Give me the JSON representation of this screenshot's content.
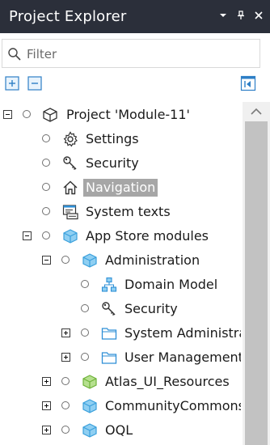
{
  "panel": {
    "title": "Project Explorer",
    "controls": [
      {
        "name": "dropdown-icon",
        "glyph": "▾"
      },
      {
        "name": "pin-icon",
        "glyph": "⊥"
      },
      {
        "name": "close-icon",
        "glyph": "✕"
      }
    ]
  },
  "filter": {
    "placeholder": "Filter",
    "value": ""
  },
  "toolbar": {
    "expand_all": "expand-all-icon",
    "collapse_all": "collapse-all-icon",
    "sync": "sync-explorer-icon"
  },
  "tree": [
    {
      "label": "Project 'Module-11'",
      "icon": "module-box-icon",
      "expander": "minus",
      "level": 0
    },
    {
      "label": "Settings",
      "icon": "gear-icon",
      "expander": "none",
      "level": 1
    },
    {
      "label": "Security",
      "icon": "key-icon",
      "expander": "none",
      "level": 1
    },
    {
      "label": "Navigation",
      "icon": "home-icon",
      "expander": "none",
      "level": 1,
      "selected": true
    },
    {
      "label": "System texts",
      "icon": "system-texts-icon",
      "expander": "none",
      "level": 1
    },
    {
      "label": "App Store modules",
      "icon": "appstore-box-icon",
      "expander": "minus",
      "level": 1
    },
    {
      "label": "Administration",
      "icon": "module-box-blue-icon",
      "expander": "minus",
      "level": 2
    },
    {
      "label": "Domain Model",
      "icon": "domain-model-icon",
      "expander": "none",
      "level": 3
    },
    {
      "label": "Security",
      "icon": "key-icon",
      "expander": "none",
      "level": 3
    },
    {
      "label": "System Administrati",
      "icon": "folder-icon",
      "expander": "plus",
      "level": 3
    },
    {
      "label": "User Management",
      "icon": "folder-icon",
      "expander": "plus",
      "level": 3
    },
    {
      "label": "Atlas_UI_Resources",
      "icon": "module-box-green-icon",
      "expander": "plus",
      "level": 2
    },
    {
      "label": "CommunityCommons",
      "icon": "module-box-blue-icon",
      "expander": "plus",
      "level": 2
    },
    {
      "label": "OQL",
      "icon": "module-box-blue-icon",
      "expander": "plus",
      "level": 2
    }
  ],
  "colors": {
    "titlebar": "#2b2f3a",
    "selection": "#a6a6a6",
    "module_blue": "#3aa0dc",
    "module_green": "#7cc242",
    "folder_blue": "#2e8fd6"
  }
}
